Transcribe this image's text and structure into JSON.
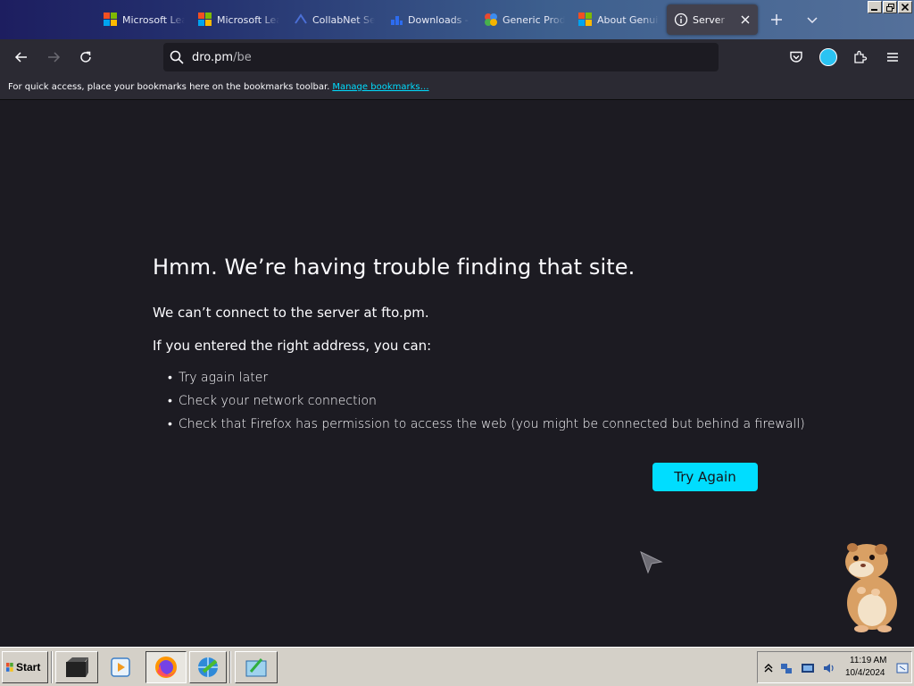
{
  "tabs": [
    {
      "title": "Microsoft Lea",
      "icon": "microsoft-logo-icon"
    },
    {
      "title": "Microsoft Lea",
      "icon": "microsoft-logo-icon"
    },
    {
      "title": "CollabNet Se",
      "icon": "collabnet-icon"
    },
    {
      "title": "Downloads -",
      "icon": "downloads-site-icon"
    },
    {
      "title": "Generic Prod",
      "icon": "generic-product-icon"
    },
    {
      "title": "About Genui",
      "icon": "microsoft-logo-icon"
    },
    {
      "title": "Server Not",
      "icon": "info-icon",
      "active": true
    }
  ],
  "toolbar": {
    "url_host": "dro.pm",
    "url_path": "/be"
  },
  "bookmarks": {
    "message": "For quick access, place your bookmarks here on the bookmarks toolbar.",
    "manage_link": "Manage bookmarks…"
  },
  "error": {
    "title": "Hmm. We’re having trouble finding that site.",
    "description": "We can’t connect to the server at fto.pm.",
    "suggestions_intro": "If you entered the right address, you can:",
    "suggestions": [
      "Try again later",
      "Check your network connection",
      "Check that Firefox has permission to access the web (you might be connected but behind a firewall)"
    ],
    "try_again_label": "Try Again"
  },
  "taskbar": {
    "start_label": "Start",
    "clock_time": "11:19 AM",
    "clock_date": "10/4/2024"
  },
  "colors": {
    "page_bg": "#1c1b22",
    "toolbar_bg": "#2b2a33",
    "accent": "#00ddff",
    "taskbar_bg": "#d4d0c8"
  }
}
